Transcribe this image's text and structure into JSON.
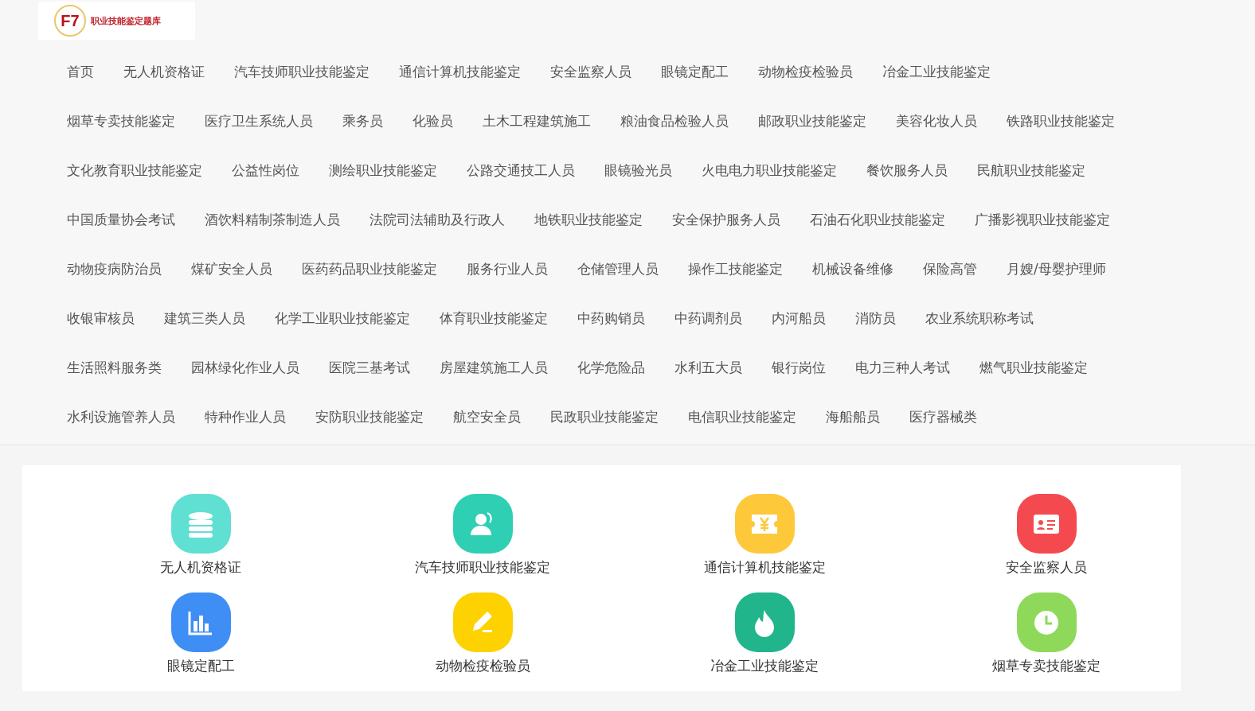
{
  "logo": {
    "mark": "F7",
    "name": "职业技能鉴定题库"
  },
  "nav_rows": [
    [
      "首页",
      "无人机资格证",
      "汽车技师职业技能鉴定",
      "通信计算机技能鉴定",
      "安全监察人员",
      "眼镜定配工",
      "动物检疫检验员",
      "冶金工业技能鉴定"
    ],
    [
      "烟草专卖技能鉴定",
      "医疗卫生系统人员",
      "乘务员",
      "化验员",
      "土木工程建筑施工",
      "粮油食品检验人员",
      "邮政职业技能鉴定",
      "美容化妆人员",
      "铁路职业技能鉴定"
    ],
    [
      "文化教育职业技能鉴定",
      "公益性岗位",
      "测绘职业技能鉴定",
      "公路交通技工人员",
      "眼镜验光员",
      "火电电力职业技能鉴定",
      "餐饮服务人员",
      "民航职业技能鉴定"
    ],
    [
      "中国质量协会考试",
      "酒饮料精制茶制造人员",
      "法院司法辅助及行政人",
      "地铁职业技能鉴定",
      "安全保护服务人员",
      "石油石化职业技能鉴定",
      "广播影视职业技能鉴定"
    ],
    [
      "动物疫病防治员",
      "煤矿安全人员",
      "医药药品职业技能鉴定",
      "服务行业人员",
      "仓储管理人员",
      "操作工技能鉴定",
      "机械设备维修",
      "保险高管",
      "月嫂/母婴护理师"
    ],
    [
      "收银审核员",
      "建筑三类人员",
      "化学工业职业技能鉴定",
      "体育职业技能鉴定",
      "中药购销员",
      "中药调剂员",
      "内河船员",
      "消防员",
      "农业系统职称考试"
    ],
    [
      "生活照料服务类",
      "园林绿化作业人员",
      "医院三基考试",
      "房屋建筑施工人员",
      "化学危险品",
      "水利五大员",
      "银行岗位",
      "电力三种人考试",
      "燃气职业技能鉴定"
    ],
    [
      "水利设施管养人员",
      "特种作业人员",
      "安防职业技能鉴定",
      "航空安全员",
      "民政职业技能鉴定",
      "电信职业技能鉴定",
      "海船船员",
      "医疗器械类"
    ]
  ],
  "categories": [
    {
      "label": "无人机资格证",
      "kind": "database",
      "color": "#5fe0d2"
    },
    {
      "label": "汽车技师职业技能鉴定",
      "kind": "user",
      "color": "#2fcfb4"
    },
    {
      "label": "通信计算机技能鉴定",
      "kind": "ticket",
      "color": "#fdc93a"
    },
    {
      "label": "安全监察人员",
      "kind": "idcard",
      "color": "#f44a4f"
    },
    {
      "label": "眼镜定配工",
      "kind": "chart",
      "color": "#3f8ef5"
    },
    {
      "label": "动物检疫检验员",
      "kind": "edit",
      "color": "#fdd200"
    },
    {
      "label": "冶金工业技能鉴定",
      "kind": "flame",
      "color": "#20b58a"
    },
    {
      "label": "烟草专卖技能鉴定",
      "kind": "clock",
      "color": "#8ed95a"
    }
  ]
}
